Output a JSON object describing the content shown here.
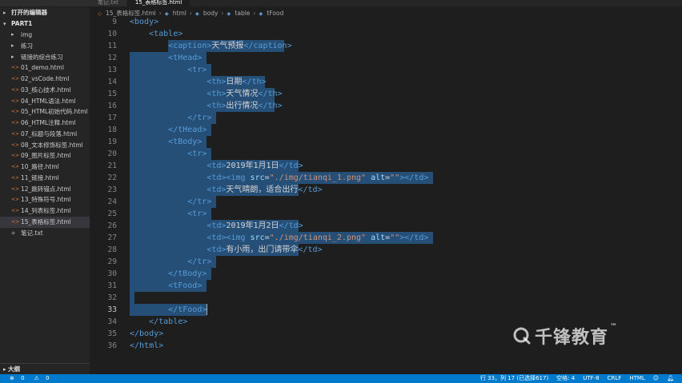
{
  "sidebar": {
    "top_strip": "",
    "open_editors_label": "打开的编辑器",
    "project_label": "PART1",
    "folders": [
      {
        "label": "img"
      },
      {
        "label": "练习"
      },
      {
        "label": "链接的综合练习"
      }
    ],
    "files": [
      {
        "label": "01_demo.html",
        "type": "html"
      },
      {
        "label": "02_vsCode.html",
        "type": "html"
      },
      {
        "label": "03_核心技术.html",
        "type": "html"
      },
      {
        "label": "04_HTML语法.html",
        "type": "html"
      },
      {
        "label": "05_HTML初始代码.html",
        "type": "html"
      },
      {
        "label": "06_HTML注释.html",
        "type": "html"
      },
      {
        "label": "07_标题与段落.html",
        "type": "html"
      },
      {
        "label": "08_文本修饰标签.html",
        "type": "html"
      },
      {
        "label": "09_图片标签.html",
        "type": "html"
      },
      {
        "label": "10_路径.html",
        "type": "html"
      },
      {
        "label": "11_链接.html",
        "type": "html"
      },
      {
        "label": "12_跳转锚点.html",
        "type": "html"
      },
      {
        "label": "13_特殊符号.html",
        "type": "html"
      },
      {
        "label": "14_列表标签.html",
        "type": "html"
      },
      {
        "label": "15_表格标签.html",
        "type": "html",
        "active": true
      },
      {
        "label": "笔记.txt",
        "type": "txt"
      }
    ],
    "outline_label": "大纲"
  },
  "tabs": [
    {
      "label": "笔记.txt",
      "active": false
    },
    {
      "label": "15_表格标签.html",
      "active": true
    }
  ],
  "breadcrumb": [
    "15_表格标签.html",
    "html",
    "body",
    "table",
    "tFood"
  ],
  "editor": {
    "lines": [
      {
        "n": "9",
        "t": "<body>"
      },
      {
        "n": "10",
        "t": "    <table>"
      },
      {
        "n": "11",
        "t": "        <caption>天气预报</caption>"
      },
      {
        "n": "12",
        "t": "        <tHead>"
      },
      {
        "n": "13",
        "t": "            <tr>"
      },
      {
        "n": "14",
        "t": "                <th>日期</th>"
      },
      {
        "n": "15",
        "t": "                <th>天气情况</th>"
      },
      {
        "n": "16",
        "t": "                <th>出行情况</th>"
      },
      {
        "n": "17",
        "t": "            </tr>"
      },
      {
        "n": "18",
        "t": "        </tHead>"
      },
      {
        "n": "19",
        "t": "        <tBody>"
      },
      {
        "n": "20",
        "t": "            <tr>"
      },
      {
        "n": "21",
        "t": "                <td>2019年1月1日</td>"
      },
      {
        "n": "22",
        "t": "                <td><img src=\"./img/tianqi_1.png\" alt=\"\"></td>"
      },
      {
        "n": "23",
        "t": "                <td>天气晴朗，适合出行</td>"
      },
      {
        "n": "24",
        "t": "            </tr>"
      },
      {
        "n": "25",
        "t": "            <tr>"
      },
      {
        "n": "26",
        "t": "                <td>2019年1月2日</td>"
      },
      {
        "n": "27",
        "t": "                <td><img src=\"./img/tianqi_2.png\" alt=\"\"></td>"
      },
      {
        "n": "28",
        "t": "                <td>有小雨，出门请带伞</td>"
      },
      {
        "n": "29",
        "t": "            </tr>"
      },
      {
        "n": "30",
        "t": "        </tBody>"
      },
      {
        "n": "31",
        "t": "        <tFood>"
      },
      {
        "n": "32",
        "t": ""
      },
      {
        "n": "33",
        "t": "        </tFood>"
      },
      {
        "n": "34",
        "t": "    </table>"
      },
      {
        "n": "35",
        "t": "</body>"
      },
      {
        "n": "36",
        "t": "</html>"
      }
    ]
  },
  "watermark": {
    "text": "千锋教育",
    "tm": "™"
  },
  "statusbar": {
    "errors": "0",
    "warnings": "0",
    "position": "行 33，列 17 (已选择617)",
    "spaces": "空格: 4",
    "encoding": "UTF-8",
    "eol": "CRLF",
    "language": "HTML"
  },
  "colors": {
    "selection": "#264f78",
    "tag": "#569cd6",
    "attr": "#9cdcfe",
    "string": "#ce9178",
    "statusbar": "#007acc"
  }
}
